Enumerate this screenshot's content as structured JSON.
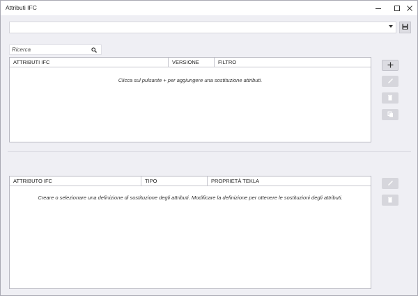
{
  "window": {
    "title": "Attributi IFC"
  },
  "combo": {
    "value": ""
  },
  "search": {
    "placeholder": "Ricerca"
  },
  "top_grid": {
    "columns": [
      "ATTRIBUTI IFC",
      "VERSIONE",
      "FILTRO"
    ],
    "empty_message": "Clicca sul pulsante + per aggiungere una sostituzione attributi."
  },
  "bottom_grid": {
    "columns": [
      "ATTRIBUTO IFC",
      "TIPO",
      "PROPRIETÀ TEKLA"
    ],
    "empty_message": "Creare o selezionare una definizione di sostituzione degli attributi. Modificare la definizione per ottenere le sostituzioni degli attributi."
  },
  "icons": {
    "minimize": "minimize-icon",
    "maximize": "maximize-icon",
    "close": "close-icon",
    "save": "save-icon",
    "search": "search-icon",
    "add": "plus-icon",
    "edit": "pencil-icon",
    "delete": "trash-icon",
    "copy": "copy-icon"
  },
  "colors": {
    "window_bg": "#efeff4",
    "button_active": "#dcdce2",
    "button_disabled": "#d6d6dc",
    "icon_disabled": "#ffffff"
  }
}
